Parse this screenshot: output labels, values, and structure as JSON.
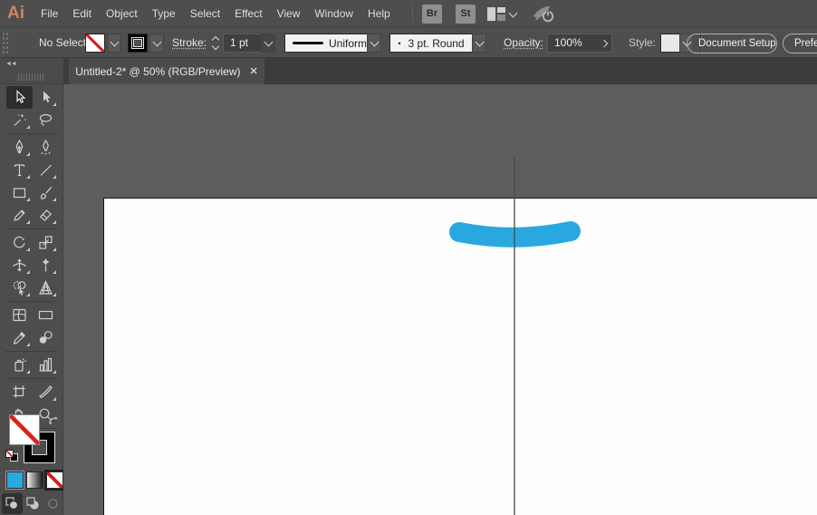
{
  "menubar": {
    "logo": "Ai",
    "items": [
      "File",
      "Edit",
      "Object",
      "Type",
      "Select",
      "Effect",
      "View",
      "Window",
      "Help"
    ],
    "bridge_button": "Br",
    "stock_button": "St"
  },
  "control_bar": {
    "selection_status": "No Selection",
    "stroke_label": "Stroke:",
    "stroke_weight": "1 pt",
    "brush_definition": "Uniform",
    "variable_width_profile": "3 pt. Round",
    "profile_glyph": "•",
    "opacity_label": "Opacity:",
    "opacity_value": "100%",
    "style_label": "Style:",
    "document_setup_button": "Document Setup",
    "preferences_button": "Preferences"
  },
  "document_tab": {
    "title": "Untitled-2* @ 50% (RGB/Preview)",
    "close_glyph": "✕",
    "collapse_glyph": "◄◄"
  },
  "toolbar": {
    "tools": [
      "selection",
      "direct-selection",
      "magic-wand",
      "lasso",
      "pen",
      "curvature",
      "type",
      "line-segment",
      "rectangle",
      "paintbrush",
      "pencil",
      "eraser",
      "rotate",
      "scale",
      "width",
      "puppet-warp",
      "shape-builder",
      "perspective-grid",
      "mesh",
      "gradient",
      "eyedropper",
      "blend",
      "symbol-sprayer",
      "column-graph",
      "artboard",
      "slice",
      "hand",
      "zoom"
    ],
    "active_tool": "selection",
    "fill": "none",
    "stroke": "black",
    "color_buttons": [
      "color",
      "gradient",
      "none"
    ],
    "drawing_modes": [
      "draw-normal",
      "draw-behind",
      "draw-inside"
    ],
    "active_drawing_mode": "draw-normal"
  },
  "canvas": {
    "brush_stroke_color": "#29a8df",
    "path_line_color": "#4b4b4b"
  }
}
